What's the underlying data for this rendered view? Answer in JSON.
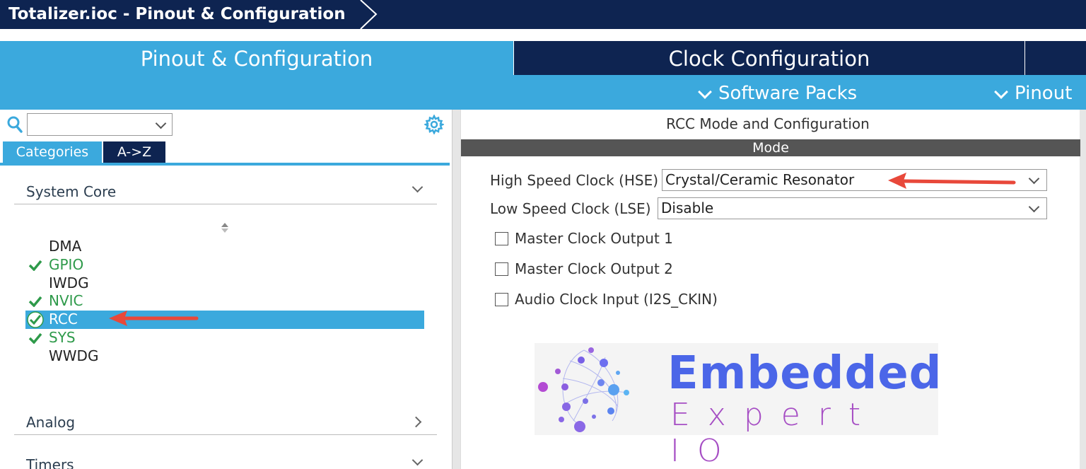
{
  "breadcrumb": {
    "title": "Totalizer.ioc - Pinout & Configuration"
  },
  "tabs": [
    {
      "label": "Pinout & Configuration",
      "active": true
    },
    {
      "label": "Clock Configuration",
      "active": false
    }
  ],
  "toolbar": {
    "software_packs": "Software Packs",
    "pinout": "Pinout"
  },
  "left_panel": {
    "search": {
      "value": ""
    },
    "tabs": {
      "categories": "Categories",
      "az": "A->Z"
    },
    "sections": {
      "system_core": "System Core",
      "analog": "Analog",
      "timers": "Timers"
    },
    "items": [
      {
        "label": "DMA",
        "status": "none"
      },
      {
        "label": "GPIO",
        "status": "ok"
      },
      {
        "label": "IWDG",
        "status": "none"
      },
      {
        "label": "NVIC",
        "status": "ok"
      },
      {
        "label": "RCC",
        "status": "selected"
      },
      {
        "label": "SYS",
        "status": "ok"
      },
      {
        "label": "WWDG",
        "status": "none"
      }
    ]
  },
  "right_panel": {
    "title": "RCC Mode and Configuration",
    "mode_header": "Mode",
    "hse": {
      "label": "High Speed Clock (HSE)",
      "value": "Crystal/Ceramic Resonator"
    },
    "lse": {
      "label": "Low Speed Clock (LSE)",
      "value": "Disable"
    },
    "checkboxes": [
      {
        "label": "Master Clock Output 1",
        "checked": false
      },
      {
        "label": "Master Clock Output 2",
        "checked": false
      },
      {
        "label": "Audio Clock Input (I2S_CKIN)",
        "checked": false
      }
    ],
    "logo": {
      "line1": "Embedded",
      "line2": "Expert IO"
    }
  },
  "colors": {
    "navy": "#0e2451",
    "accent": "#3ba9dd",
    "ok_green": "#2e9a4a",
    "arrow_red": "#e8483a"
  }
}
